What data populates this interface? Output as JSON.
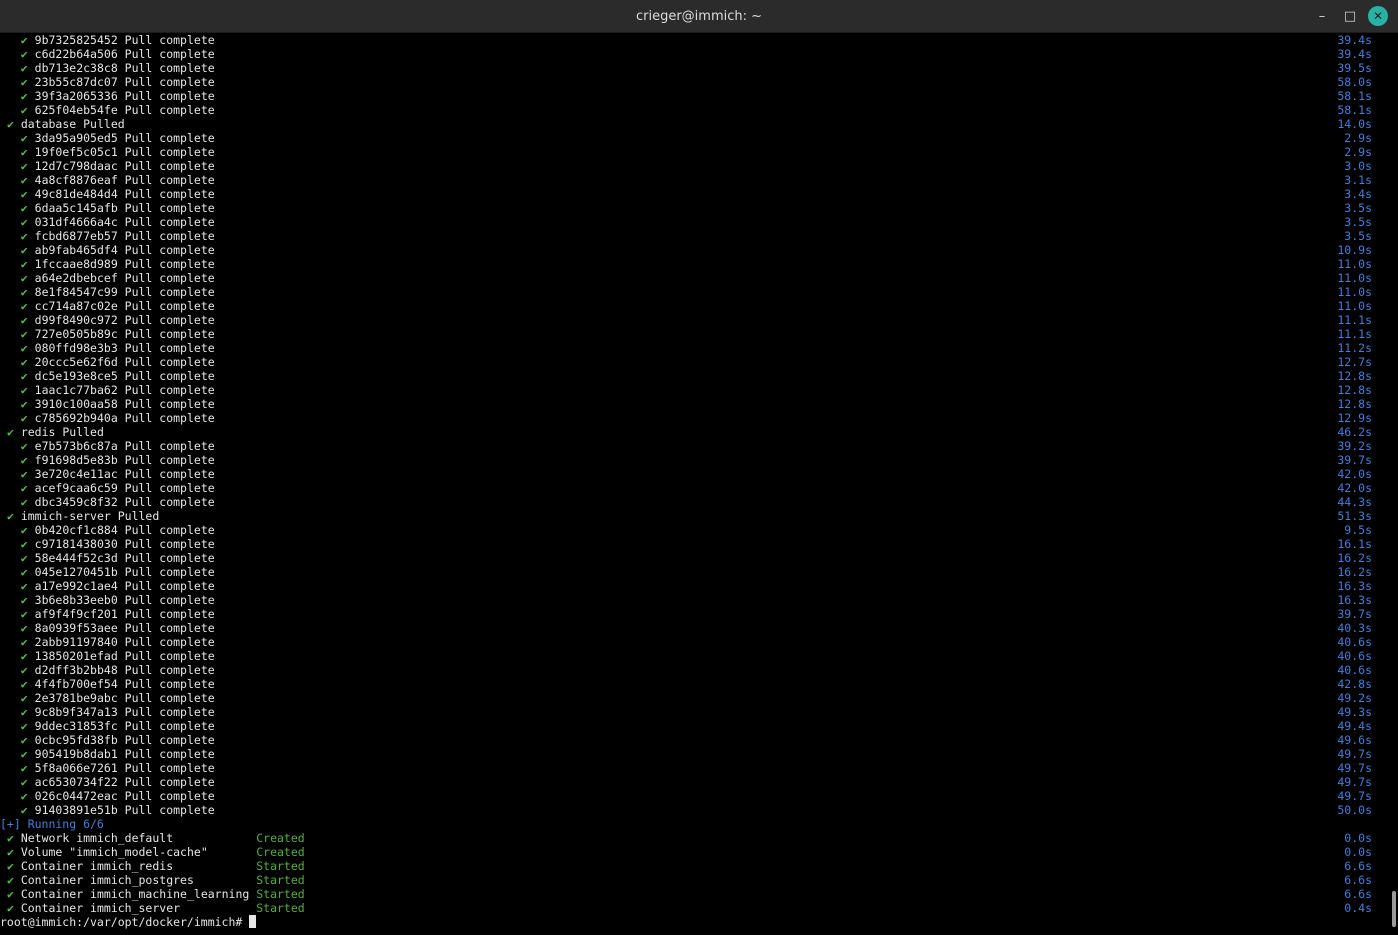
{
  "window": {
    "title": "crieger@immich: ~",
    "minimize": "–",
    "maximize": "□",
    "close": "✕"
  },
  "lines": [
    {
      "type": "layer",
      "check": "✔",
      "text": "9b7325825452 Pull complete",
      "time": "39.4s"
    },
    {
      "type": "layer",
      "check": "✔",
      "text": "c6d22b64a506 Pull complete",
      "time": "39.4s"
    },
    {
      "type": "layer",
      "check": "✔",
      "text": "db713e2c38c8 Pull complete",
      "time": "39.5s"
    },
    {
      "type": "layer",
      "check": "✔",
      "text": "23b55c87dc07 Pull complete",
      "time": "58.0s"
    },
    {
      "type": "layer",
      "check": "✔",
      "text": "39f3a2065336 Pull complete",
      "time": "58.1s"
    },
    {
      "type": "layer",
      "check": "✔",
      "text": "625f04eb54fe Pull complete",
      "time": "58.1s"
    },
    {
      "type": "service",
      "check": "✔",
      "text": "database Pulled",
      "time": "14.0s"
    },
    {
      "type": "layer",
      "check": "✔",
      "text": "3da95a905ed5 Pull complete",
      "time": "2.9s"
    },
    {
      "type": "layer",
      "check": "✔",
      "text": "19f0ef5c05c1 Pull complete",
      "time": "2.9s"
    },
    {
      "type": "layer",
      "check": "✔",
      "text": "12d7c798daac Pull complete",
      "time": "3.0s"
    },
    {
      "type": "layer",
      "check": "✔",
      "text": "4a8cf8876eaf Pull complete",
      "time": "3.1s"
    },
    {
      "type": "layer",
      "check": "✔",
      "text": "49c81de484d4 Pull complete",
      "time": "3.4s"
    },
    {
      "type": "layer",
      "check": "✔",
      "text": "6daa5c145afb Pull complete",
      "time": "3.5s"
    },
    {
      "type": "layer",
      "check": "✔",
      "text": "031df4666a4c Pull complete",
      "time": "3.5s"
    },
    {
      "type": "layer",
      "check": "✔",
      "text": "fcbd6877eb57 Pull complete",
      "time": "3.5s"
    },
    {
      "type": "layer",
      "check": "✔",
      "text": "ab9fab465df4 Pull complete",
      "time": "10.9s"
    },
    {
      "type": "layer",
      "check": "✔",
      "text": "1fccaae8d989 Pull complete",
      "time": "11.0s"
    },
    {
      "type": "layer",
      "check": "✔",
      "text": "a64e2dbebcef Pull complete",
      "time": "11.0s"
    },
    {
      "type": "layer",
      "check": "✔",
      "text": "8e1f84547c99 Pull complete",
      "time": "11.0s"
    },
    {
      "type": "layer",
      "check": "✔",
      "text": "cc714a87c02e Pull complete",
      "time": "11.0s"
    },
    {
      "type": "layer",
      "check": "✔",
      "text": "d99f8490c972 Pull complete",
      "time": "11.1s"
    },
    {
      "type": "layer",
      "check": "✔",
      "text": "727e0505b89c Pull complete",
      "time": "11.1s"
    },
    {
      "type": "layer",
      "check": "✔",
      "text": "080ffd98e3b3 Pull complete",
      "time": "11.2s"
    },
    {
      "type": "layer",
      "check": "✔",
      "text": "20ccc5e62f6d Pull complete",
      "time": "12.7s"
    },
    {
      "type": "layer",
      "check": "✔",
      "text": "dc5e193e8ce5 Pull complete",
      "time": "12.8s"
    },
    {
      "type": "layer",
      "check": "✔",
      "text": "1aac1c77ba62 Pull complete",
      "time": "12.8s"
    },
    {
      "type": "layer",
      "check": "✔",
      "text": "3910c100aa58 Pull complete",
      "time": "12.8s"
    },
    {
      "type": "layer",
      "check": "✔",
      "text": "c785692b940a Pull complete",
      "time": "12.9s"
    },
    {
      "type": "service",
      "check": "✔",
      "text": "redis Pulled",
      "time": "46.2s"
    },
    {
      "type": "layer",
      "check": "✔",
      "text": "e7b573b6c87a Pull complete",
      "time": "39.2s"
    },
    {
      "type": "layer",
      "check": "✔",
      "text": "f91698d5e83b Pull complete",
      "time": "39.7s"
    },
    {
      "type": "layer",
      "check": "✔",
      "text": "3e720c4e11ac Pull complete",
      "time": "42.0s"
    },
    {
      "type": "layer",
      "check": "✔",
      "text": "acef9caa6c59 Pull complete",
      "time": "42.0s"
    },
    {
      "type": "layer",
      "check": "✔",
      "text": "dbc3459c8f32 Pull complete",
      "time": "44.3s"
    },
    {
      "type": "service",
      "check": "✔",
      "text": "immich-server Pulled",
      "time": "51.3s"
    },
    {
      "type": "layer",
      "check": "✔",
      "text": "0b420cf1c884 Pull complete",
      "time": "9.5s"
    },
    {
      "type": "layer",
      "check": "✔",
      "text": "c97181438030 Pull complete",
      "time": "16.1s"
    },
    {
      "type": "layer",
      "check": "✔",
      "text": "58e444f52c3d Pull complete",
      "time": "16.2s"
    },
    {
      "type": "layer",
      "check": "✔",
      "text": "045e1270451b Pull complete",
      "time": "16.2s"
    },
    {
      "type": "layer",
      "check": "✔",
      "text": "a17e992c1ae4 Pull complete",
      "time": "16.3s"
    },
    {
      "type": "layer",
      "check": "✔",
      "text": "3b6e8b33eeb0 Pull complete",
      "time": "16.3s"
    },
    {
      "type": "layer",
      "check": "✔",
      "text": "af9f4f9cf201 Pull complete",
      "time": "39.7s"
    },
    {
      "type": "layer",
      "check": "✔",
      "text": "8a0939f53aee Pull complete",
      "time": "40.3s"
    },
    {
      "type": "layer",
      "check": "✔",
      "text": "2abb91197840 Pull complete",
      "time": "40.6s"
    },
    {
      "type": "layer",
      "check": "✔",
      "text": "13850201efad Pull complete",
      "time": "40.6s"
    },
    {
      "type": "layer",
      "check": "✔",
      "text": "d2dff3b2bb48 Pull complete",
      "time": "40.6s"
    },
    {
      "type": "layer",
      "check": "✔",
      "text": "4f4fb700ef54 Pull complete",
      "time": "42.8s"
    },
    {
      "type": "layer",
      "check": "✔",
      "text": "2e3781be9abc Pull complete",
      "time": "49.2s"
    },
    {
      "type": "layer",
      "check": "✔",
      "text": "9c8b9f347a13 Pull complete",
      "time": "49.3s"
    },
    {
      "type": "layer",
      "check": "✔",
      "text": "9ddec31853fc Pull complete",
      "time": "49.4s"
    },
    {
      "type": "layer",
      "check": "✔",
      "text": "0cbc95fd38fb Pull complete",
      "time": "49.6s"
    },
    {
      "type": "layer",
      "check": "✔",
      "text": "905419b8dab1 Pull complete",
      "time": "49.7s"
    },
    {
      "type": "layer",
      "check": "✔",
      "text": "5f8a066e7261 Pull complete",
      "time": "49.7s"
    },
    {
      "type": "layer",
      "check": "✔",
      "text": "ac6530734f22 Pull complete",
      "time": "49.7s"
    },
    {
      "type": "layer",
      "check": "✔",
      "text": "026c04472eac Pull complete",
      "time": "49.7s"
    },
    {
      "type": "layer",
      "check": "✔",
      "text": "91403891e51b Pull complete",
      "time": "50.0s"
    },
    {
      "type": "running",
      "text": "[+] Running 6/6"
    },
    {
      "type": "resource",
      "check": "✔",
      "text": "Network immich_default",
      "status": "Created",
      "time": "0.0s"
    },
    {
      "type": "resource",
      "check": "✔",
      "text": "Volume \"immich_model-cache\"",
      "status": "Created",
      "time": "0.0s"
    },
    {
      "type": "resource",
      "check": "✔",
      "text": "Container immich_redis",
      "status": "Started",
      "time": "6.6s"
    },
    {
      "type": "resource",
      "check": "✔",
      "text": "Container immich_postgres",
      "status": "Started",
      "time": "6.6s"
    },
    {
      "type": "resource",
      "check": "✔",
      "text": "Container immich_machine_learning",
      "status": "Started",
      "time": "6.6s"
    },
    {
      "type": "resource",
      "check": "✔",
      "text": "Container immich_server",
      "status": "Started",
      "time": "0.4s"
    }
  ],
  "prompt": "root@immich:/var/opt/docker/immich# "
}
